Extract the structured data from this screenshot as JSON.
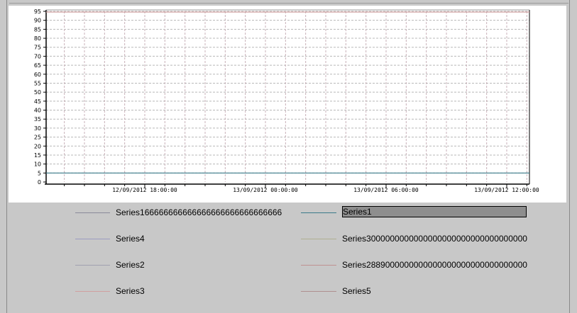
{
  "chart_data": {
    "type": "line",
    "ylim": [
      0,
      95
    ],
    "y_ticks": [
      0,
      5,
      10,
      15,
      20,
      25,
      30,
      35,
      40,
      45,
      50,
      55,
      60,
      65,
      70,
      75,
      80,
      85,
      90,
      95
    ],
    "x_ticks": [
      "12/09/2012 18:00:00",
      "13/09/2012 00:00:00",
      "13/09/2012 06:00:00",
      "13/09/2012 12:00:00"
    ],
    "grid": true,
    "legend_position": "bottom",
    "series": [
      {
        "name": "Series166666666666666666666666666666",
        "color": "#8a8a9a",
        "values": []
      },
      {
        "name": "Series1",
        "color": "#3a7a8a",
        "values": [
          5,
          5
        ],
        "selected": true
      },
      {
        "name": "Series4",
        "color": "#9a9ac0",
        "values": []
      },
      {
        "name": "Series3000000000000000000000000000000000",
        "color": "#b0b090",
        "values": []
      },
      {
        "name": "Series2",
        "color": "#a0a0b0",
        "values": []
      },
      {
        "name": "Series2889000000000000000000000000000000",
        "color": "#c09090",
        "values": []
      },
      {
        "name": "Series3",
        "color": "#d0a0a0",
        "values": [
          95,
          95
        ]
      },
      {
        "name": "Series5",
        "color": "#b09090",
        "values": []
      }
    ]
  }
}
